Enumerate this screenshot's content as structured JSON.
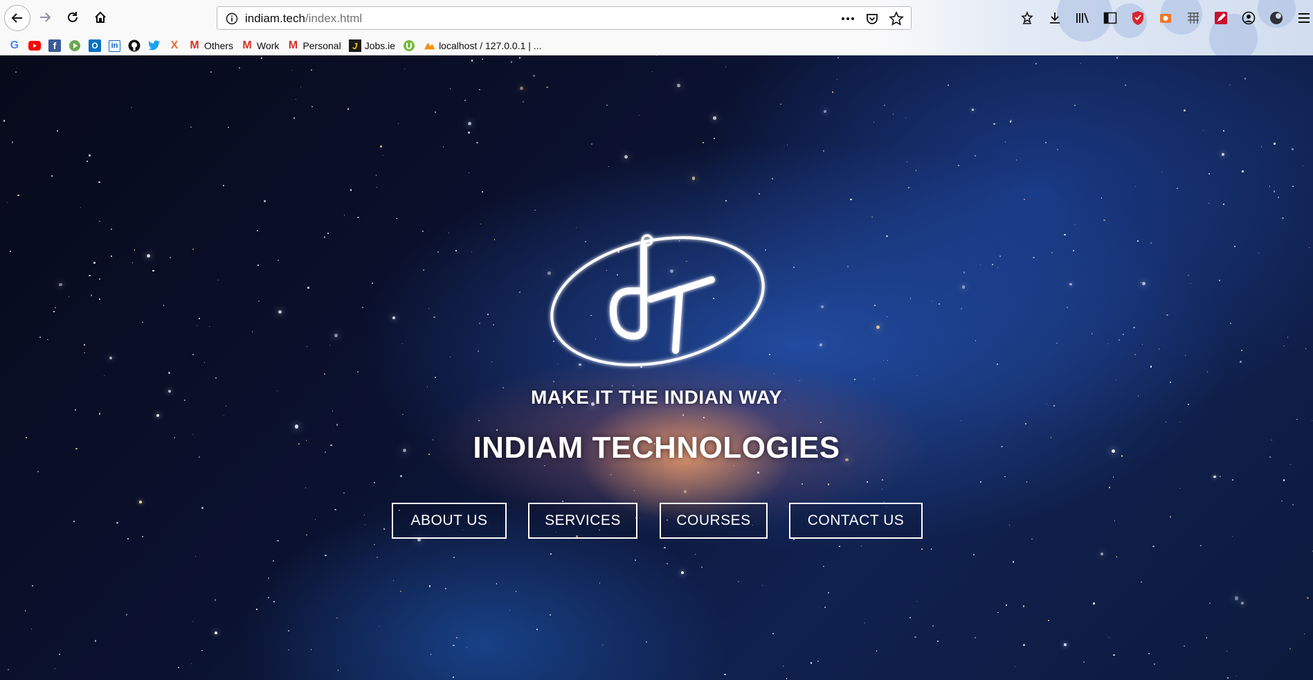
{
  "browser": {
    "url_domain": "indiam.tech",
    "url_path": "/index.html",
    "bookmarks": [
      {
        "icon": "google-icon",
        "label": ""
      },
      {
        "icon": "youtube-icon",
        "label": ""
      },
      {
        "icon": "facebook-icon",
        "label": ""
      },
      {
        "icon": "play-icon",
        "label": ""
      },
      {
        "icon": "outlook-icon",
        "label": ""
      },
      {
        "icon": "linkedin-icon",
        "label": ""
      },
      {
        "icon": "github-icon",
        "label": ""
      },
      {
        "icon": "twitter-icon",
        "label": ""
      },
      {
        "icon": "x-icon",
        "label": ""
      },
      {
        "icon": "gmail-icon",
        "label": "Others"
      },
      {
        "icon": "gmail-icon",
        "label": "Work"
      },
      {
        "icon": "gmail-icon",
        "label": "Personal"
      },
      {
        "icon": "jobs-icon",
        "label": "Jobs.ie"
      },
      {
        "icon": "utorrent-icon",
        "label": ""
      },
      {
        "icon": "phpmyadmin-icon",
        "label": "localhost / 127.0.0.1 | ..."
      }
    ]
  },
  "hero": {
    "tagline": "MAKE IT THE INDIAN WAY",
    "company": "INDIAM TECHNOLOGIES",
    "menu": [
      "ABOUT US",
      "SERVICES",
      "COURSES",
      "CONTACT US"
    ]
  },
  "colors": {
    "accent": "#ffffff",
    "space_dark": "#070a1a",
    "galaxy_blue": "#285abe",
    "galaxy_core": "#ffaa6e"
  }
}
